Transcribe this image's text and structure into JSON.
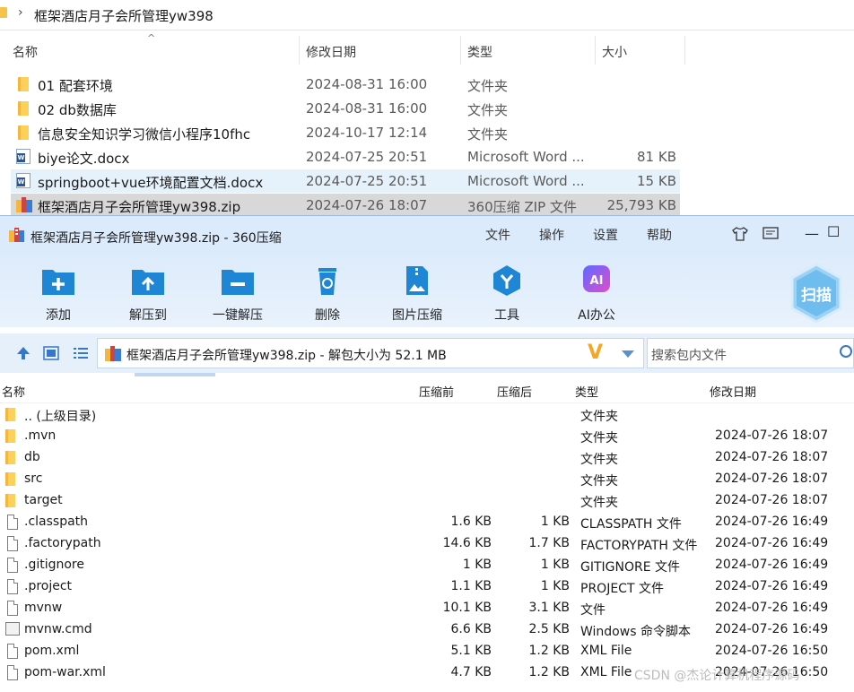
{
  "explorer": {
    "path": "框架酒店月子会所管理yw398",
    "columns": {
      "name": "名称",
      "date": "修改日期",
      "type": "类型",
      "size": "大小"
    },
    "rows": [
      {
        "name": "01 配套环境",
        "date": "2024-08-31 16:00",
        "type": "文件夹",
        "size": "",
        "icon": "folder-icon"
      },
      {
        "name": "02 db数据库",
        "date": "2024-08-31 16:00",
        "type": "文件夹",
        "size": "",
        "icon": "folder-icon"
      },
      {
        "name": "信息安全知识学习微信小程序10fhc",
        "date": "2024-10-17 12:14",
        "type": "文件夹",
        "size": "",
        "icon": "folder-icon"
      },
      {
        "name": "biye论文.docx",
        "date": "2024-07-25 20:51",
        "type": "Microsoft Word ...",
        "size": "81 KB",
        "icon": "word-doc-icon"
      },
      {
        "name": "springboot+vue环境配置文档.docx",
        "date": "2024-07-25 20:51",
        "type": "Microsoft Word ...",
        "size": "15 KB",
        "icon": "word-doc-icon"
      },
      {
        "name": "框架酒店月子会所管理yw398.zip",
        "date": "2024-07-26 18:07",
        "type": "360压缩 ZIP 文件",
        "size": "25,793 KB",
        "icon": "zip-archive-icon"
      }
    ]
  },
  "archiver": {
    "title": "框架酒店月子会所管理yw398.zip - 360压缩",
    "menu": [
      "文件",
      "操作",
      "设置",
      "帮助"
    ],
    "toolbar": [
      {
        "label": "添加",
        "icon": "add-icon"
      },
      {
        "label": "解压到",
        "icon": "extract-to-icon"
      },
      {
        "label": "一键解压",
        "icon": "quick-extract-icon"
      },
      {
        "label": "删除",
        "icon": "delete-icon"
      },
      {
        "label": "图片压缩",
        "icon": "image-compress-icon"
      },
      {
        "label": "工具",
        "icon": "tools-icon"
      },
      {
        "label": "AI办公",
        "icon": "ai-office-icon"
      }
    ],
    "scan_label": "扫描",
    "path_text": "框架酒店月子会所管理yw398.zip - 解包大小为 52.1 MB",
    "search_placeholder": "搜索包内文件",
    "columns": {
      "name": "名称",
      "compressed_before": "压缩前",
      "compressed_after": "压缩后",
      "type": "类型",
      "date": "修改日期"
    },
    "rows": [
      {
        "name": ".. (上级目录)",
        "before": "",
        "after": "",
        "type": "文件夹",
        "date": "",
        "icon": "folder-icon"
      },
      {
        "name": ".mvn",
        "before": "",
        "after": "",
        "type": "文件夹",
        "date": "2024-07-26 18:07",
        "icon": "folder-icon"
      },
      {
        "name": "db",
        "before": "",
        "after": "",
        "type": "文件夹",
        "date": "2024-07-26 18:07",
        "icon": "folder-icon"
      },
      {
        "name": "src",
        "before": "",
        "after": "",
        "type": "文件夹",
        "date": "2024-07-26 18:07",
        "icon": "folder-icon"
      },
      {
        "name": "target",
        "before": "",
        "after": "",
        "type": "文件夹",
        "date": "2024-07-26 18:07",
        "icon": "folder-icon"
      },
      {
        "name": ".classpath",
        "before": "1.6 KB",
        "after": "1 KB",
        "type": "CLASSPATH 文件",
        "date": "2024-07-26 16:49",
        "icon": "file-icon"
      },
      {
        "name": ".factorypath",
        "before": "14.6 KB",
        "after": "1.7 KB",
        "type": "FACTORYPATH 文件",
        "date": "2024-07-26 16:49",
        "icon": "file-icon"
      },
      {
        "name": ".gitignore",
        "before": "1 KB",
        "after": "1 KB",
        "type": "GITIGNORE 文件",
        "date": "2024-07-26 16:49",
        "icon": "file-icon"
      },
      {
        "name": ".project",
        "before": "1.1 KB",
        "after": "1 KB",
        "type": "PROJECT 文件",
        "date": "2024-07-26 16:49",
        "icon": "file-icon"
      },
      {
        "name": "mvnw",
        "before": "10.1 KB",
        "after": "3.1 KB",
        "type": "文件",
        "date": "2024-07-26 16:49",
        "icon": "file-icon"
      },
      {
        "name": "mvnw.cmd",
        "before": "6.6 KB",
        "after": "2.5 KB",
        "type": "Windows 命令脚本",
        "date": "2024-07-26 16:49",
        "icon": "cmd-script-icon"
      },
      {
        "name": "pom.xml",
        "before": "5.1 KB",
        "after": "1.2 KB",
        "type": "XML File",
        "date": "2024-07-26 16:50",
        "icon": "file-icon"
      },
      {
        "name": "pom-war.xml",
        "before": "4.7 KB",
        "after": "1.2 KB",
        "type": "XML File",
        "date": "2024-07-26 16:50",
        "icon": "file-icon"
      }
    ]
  },
  "watermark": "CSDN @杰论计算机程序源码",
  "colors": {
    "accent_blue": "#1f86d6",
    "titlebar": "#dcebfb",
    "folder": "#f4b73c",
    "selection": "#d8d8d8"
  }
}
